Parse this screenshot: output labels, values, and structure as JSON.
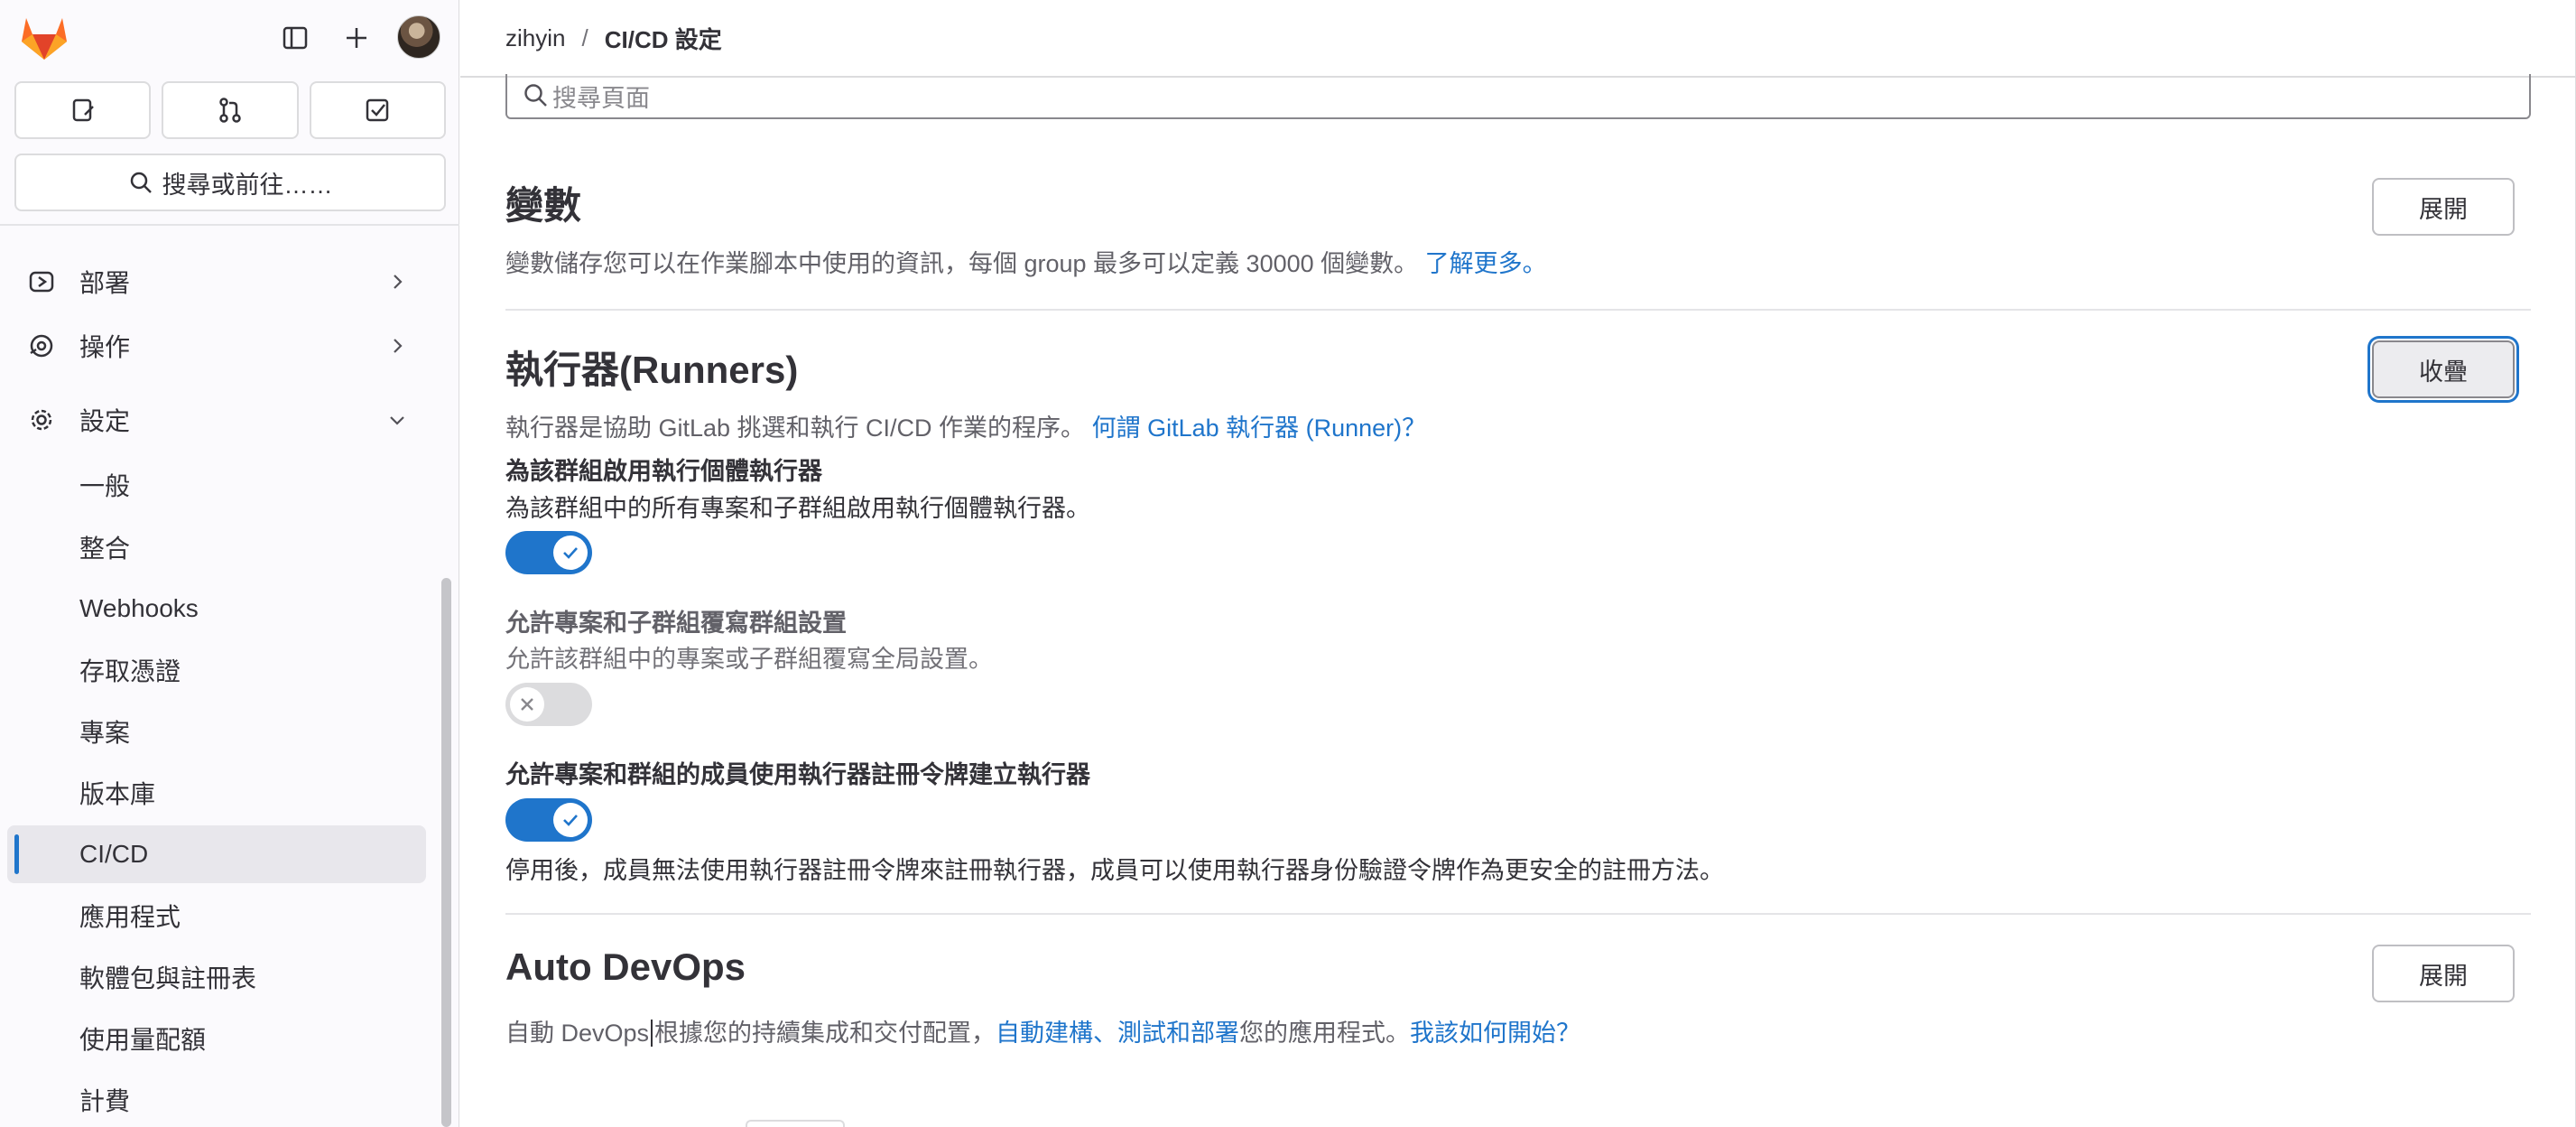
{
  "colors": {
    "accent": "#1f75cb",
    "sidebar_bg": "#fbfafd",
    "active_nav_bg": "#e8e7ec",
    "text": "#333238",
    "muted_text": "#626168",
    "toggle_off": "#dcdcde"
  },
  "sidebar": {
    "logo_icon": "gitlab-tanuki-logo",
    "top_icons": [
      "sidebar-toggle-icon",
      "plus-icon",
      "user-avatar"
    ],
    "counters": [
      "issues-icon",
      "merge-requests-icon",
      "todo-icon"
    ],
    "search_label": "搜尋或前往……",
    "nav": [
      {
        "label": "部署",
        "icon": "deploy-icon",
        "expandable": true
      },
      {
        "label": "操作",
        "icon": "operate-icon",
        "expandable": true
      },
      {
        "label": "設定",
        "icon": "settings-icon",
        "expandable": true,
        "expanded": true
      },
      {
        "label": "一般"
      },
      {
        "label": "整合"
      },
      {
        "label": "Webhooks"
      },
      {
        "label": "存取憑證"
      },
      {
        "label": "專案"
      },
      {
        "label": "版本庫"
      },
      {
        "label": "CI/CD",
        "active": true
      },
      {
        "label": "應用程式"
      },
      {
        "label": "軟體包與註冊表"
      },
      {
        "label": "使用量配額"
      },
      {
        "label": "計費"
      }
    ]
  },
  "breadcrumb": {
    "parent": "zihyin",
    "separator": "/",
    "current": "CI/CD 設定"
  },
  "page_search": {
    "placeholder": "搜尋頁面"
  },
  "sections": {
    "variables": {
      "title": "變數",
      "description": "變數儲存您可以在作業腳本中使用的資訊，每個 group 最多可以定義 30000 個變數。",
      "link": "了解更多。",
      "button": "展開"
    },
    "runners": {
      "title": "執行器(Runners)",
      "description": "執行器是協助 GitLab 挑選和執行 CI/CD 作業的程序。",
      "link": "何謂 GitLab 執行器 (Runner)？",
      "button": "收疊",
      "settings": [
        {
          "label": "為該群組啟用執行個體執行器",
          "help": "為該群組中的所有專案和子群組啟用執行個體執行器。",
          "enabled": true
        },
        {
          "label": "允許專案和子群組覆寫群組設置",
          "help": "允許該群組中的專案或子群組覆寫全局設置。",
          "enabled": false
        },
        {
          "label": "允許專案和群組的成員使用執行器註冊令牌建立執行器",
          "help": "停用後，成員無法使用執行器註冊令牌來註冊執行器，成員可以使用執行器身份驗證令牌作為更安全的註冊方法。",
          "enabled": true
        }
      ]
    },
    "auto_devops": {
      "title": "Auto DevOps",
      "description_prefix": "自動 DevOps",
      "description_middle": "根據您的持續集成和交付配置，",
      "link1": "自動建構、測試和部署",
      "description_suffix": "您的應用程式。",
      "link2": "我該如何開始？",
      "button": "展開"
    }
  }
}
